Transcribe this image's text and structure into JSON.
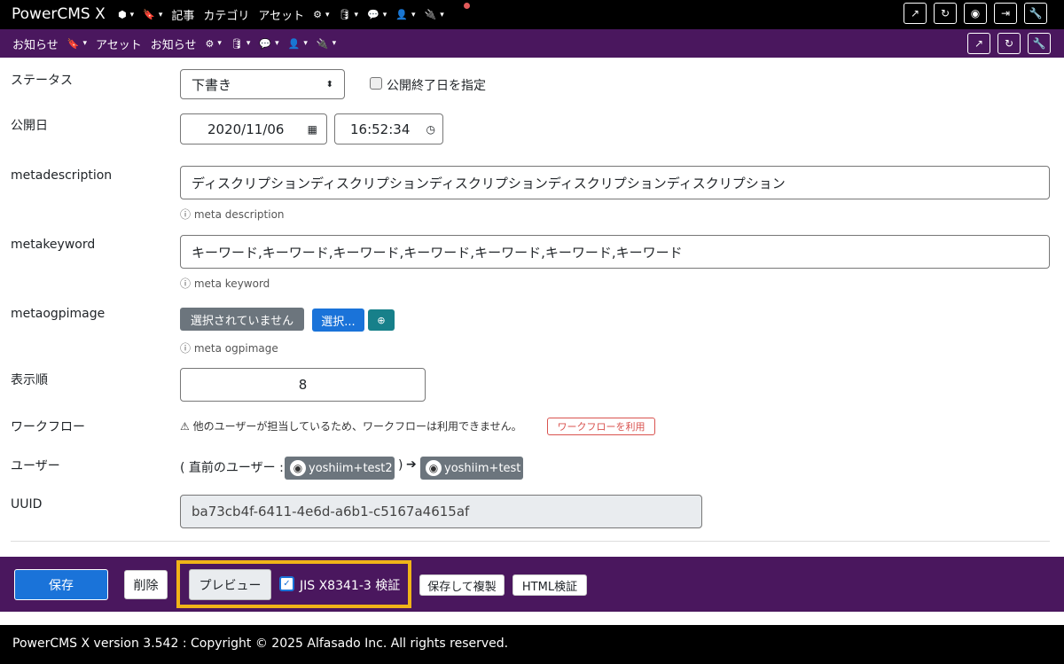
{
  "app": {
    "brand": "PowerCMS X"
  },
  "topnav": {
    "items": [
      {
        "icon": "cube-icon",
        "glyph": "⬢",
        "label": "",
        "caret": "▾"
      },
      {
        "icon": "bookmark-icon",
        "glyph": "🔖",
        "label": "",
        "caret": "▾"
      },
      {
        "icon": "",
        "glyph": "",
        "label": "記事",
        "caret": ""
      },
      {
        "icon": "",
        "glyph": "",
        "label": "カテゴリ",
        "caret": ""
      },
      {
        "icon": "",
        "glyph": "",
        "label": "アセット",
        "caret": ""
      },
      {
        "icon": "gear-icon",
        "glyph": "⚙",
        "label": "",
        "caret": "▾"
      },
      {
        "icon": "database-icon",
        "glyph": "🛢",
        "label": "",
        "caret": "▾"
      },
      {
        "icon": "comments-icon",
        "glyph": "💬",
        "label": "",
        "caret": "▾"
      },
      {
        "icon": "user-plus-icon",
        "glyph": "👤",
        "label": "",
        "caret": "▾"
      },
      {
        "icon": "plug-icon",
        "glyph": "🔌",
        "label": "",
        "caret": "▾"
      }
    ],
    "right_icons": [
      "external-link-icon",
      "refresh-icon",
      "user-circle-icon",
      "sign-out-icon",
      "wrench-icon"
    ],
    "right_glyphs": [
      "↗",
      "↻",
      "◉",
      "⇥",
      "🔧"
    ]
  },
  "subnav": {
    "items": [
      {
        "icon": "",
        "glyph": "",
        "label": "お知らせ",
        "caret": ""
      },
      {
        "icon": "bookmark-icon",
        "glyph": "🔖",
        "label": "",
        "caret": "▾"
      },
      {
        "icon": "",
        "glyph": "",
        "label": "アセット",
        "caret": ""
      },
      {
        "icon": "",
        "glyph": "",
        "label": "お知らせ",
        "caret": ""
      },
      {
        "icon": "gear-icon",
        "glyph": "⚙",
        "label": "",
        "caret": "▾"
      },
      {
        "icon": "database-icon",
        "glyph": "🛢",
        "label": "",
        "caret": "▾"
      },
      {
        "icon": "comments-icon",
        "glyph": "💬",
        "label": "",
        "caret": "▾"
      },
      {
        "icon": "user-plus-icon",
        "glyph": "👤",
        "label": "",
        "caret": "▾"
      },
      {
        "icon": "plug-icon",
        "glyph": "🔌",
        "label": "",
        "caret": "▾"
      }
    ],
    "right_icons": [
      "external-link-icon",
      "refresh-icon",
      "wrench-icon"
    ],
    "right_glyphs": [
      "↗",
      "↻",
      "🔧"
    ]
  },
  "form": {
    "status": {
      "label": "ステータス",
      "value": "下書き",
      "end_date_checkbox": "公開終了日を指定"
    },
    "published": {
      "label": "公開日",
      "date": "2020/11/06",
      "time": "16:52:34"
    },
    "metadescription": {
      "label": "metadescription",
      "value": "ディスクリプションディスクリプションディスクリプションディスクリプションディスクリプション",
      "help": "meta description"
    },
    "metakeyword": {
      "label": "metakeyword",
      "value": "キーワード,キーワード,キーワード,キーワード,キーワード,キーワード,キーワード",
      "help": "meta keyword"
    },
    "metaogpimage": {
      "label": "metaogpimage",
      "none": "選択されていません",
      "select": "選択...",
      "help": "meta ogpimage"
    },
    "order": {
      "label": "表示順",
      "value": "8"
    },
    "workflow": {
      "label": "ワークフロー",
      "notice": "他のユーザーが担当しているため、ワークフローは利用できません。",
      "button": "ワークフローを利用"
    },
    "user": {
      "label": "ユーザー",
      "prefix": "( 直前のユーザー :",
      "previous": "yoshiim+test2",
      "suffix": ")",
      "current": "yoshiim+test"
    },
    "uuid": {
      "label": "UUID",
      "value": "ba73cb4f-6411-4e6d-a6b1-c5167a4615af"
    }
  },
  "actions": {
    "save": "保存",
    "delete": "削除",
    "preview": "プレビュー",
    "jis_check": "JIS X8341-3 検証",
    "save_copy": "保存して複製",
    "html_check": "HTML検証"
  },
  "footer": {
    "copyright": "PowerCMS X version 3.542 : Copyright © 2025 Alfasado Inc. All rights reserved."
  },
  "colors": {
    "topbar": "#000000",
    "purple": "#4a175e",
    "primary": "#1a73d9",
    "highlight": "#f0b418",
    "teal": "#17808a",
    "danger": "#d9534f"
  }
}
